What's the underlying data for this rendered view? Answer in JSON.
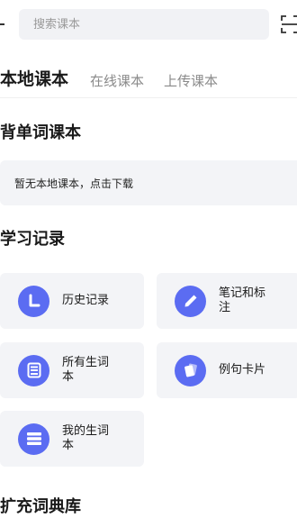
{
  "search": {
    "placeholder": "搜索课本"
  },
  "tabs": [
    {
      "label": "本地课本",
      "active": true
    },
    {
      "label": "在线课本",
      "active": false
    },
    {
      "label": "上传课本",
      "active": false
    }
  ],
  "sections": {
    "recite": {
      "title": "背单词课本",
      "empty_text": "暂无本地课本，点击下载"
    },
    "records": {
      "title": "学习记录",
      "items": [
        {
          "label": "历史记录",
          "icon": "clock-icon"
        },
        {
          "label": "笔记和标注",
          "icon": "pencil-icon"
        },
        {
          "label": "所有生词本",
          "icon": "book-icon"
        },
        {
          "label": "例句卡片",
          "icon": "cards-icon"
        },
        {
          "label": "我的生词本",
          "icon": "list-icon"
        }
      ]
    },
    "extend": {
      "title": "扩充词典库"
    }
  },
  "colors": {
    "accent": "#5b6cf2",
    "card_bg": "#f3f4f7"
  }
}
